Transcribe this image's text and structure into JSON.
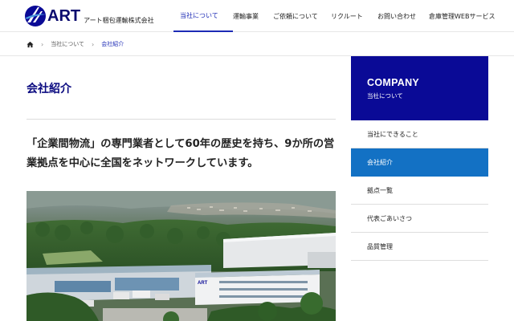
{
  "header": {
    "logo_text": "ART",
    "logo_subtitle": "アート梱包運輸株式会社",
    "nav": [
      {
        "label": "当社について",
        "active": true
      },
      {
        "label": "運輸事業",
        "active": false
      },
      {
        "label": "ご依頼について",
        "active": false
      },
      {
        "label": "リクルート",
        "active": false
      },
      {
        "label": "お問い合わせ",
        "active": false
      },
      {
        "label": "倉庫管理WEBサービス",
        "active": false
      }
    ]
  },
  "breadcrumb": {
    "home_icon": "home-icon",
    "items": [
      "当社について",
      "会社紹介"
    ]
  },
  "main": {
    "page_title": "会社紹介",
    "lead": "「企業間物流」の専門業者として60年の歴史を持ち、9か所の営業拠点を中心に全国をネットワークしています。",
    "photo_building_logo": "ART"
  },
  "sidebar": {
    "title": "COMPANY",
    "subtitle": "当社について",
    "items": [
      {
        "label": "当社にできること",
        "active": false
      },
      {
        "label": "会社紹介",
        "active": true
      },
      {
        "label": "拠点一覧",
        "active": false
      },
      {
        "label": "代表ごあいさつ",
        "active": false
      },
      {
        "label": "品質管理",
        "active": false
      }
    ]
  },
  "colors": {
    "brand_navy": "#0a0a96",
    "accent_blue": "#1d2bb5",
    "active_item": "#1371c4"
  }
}
